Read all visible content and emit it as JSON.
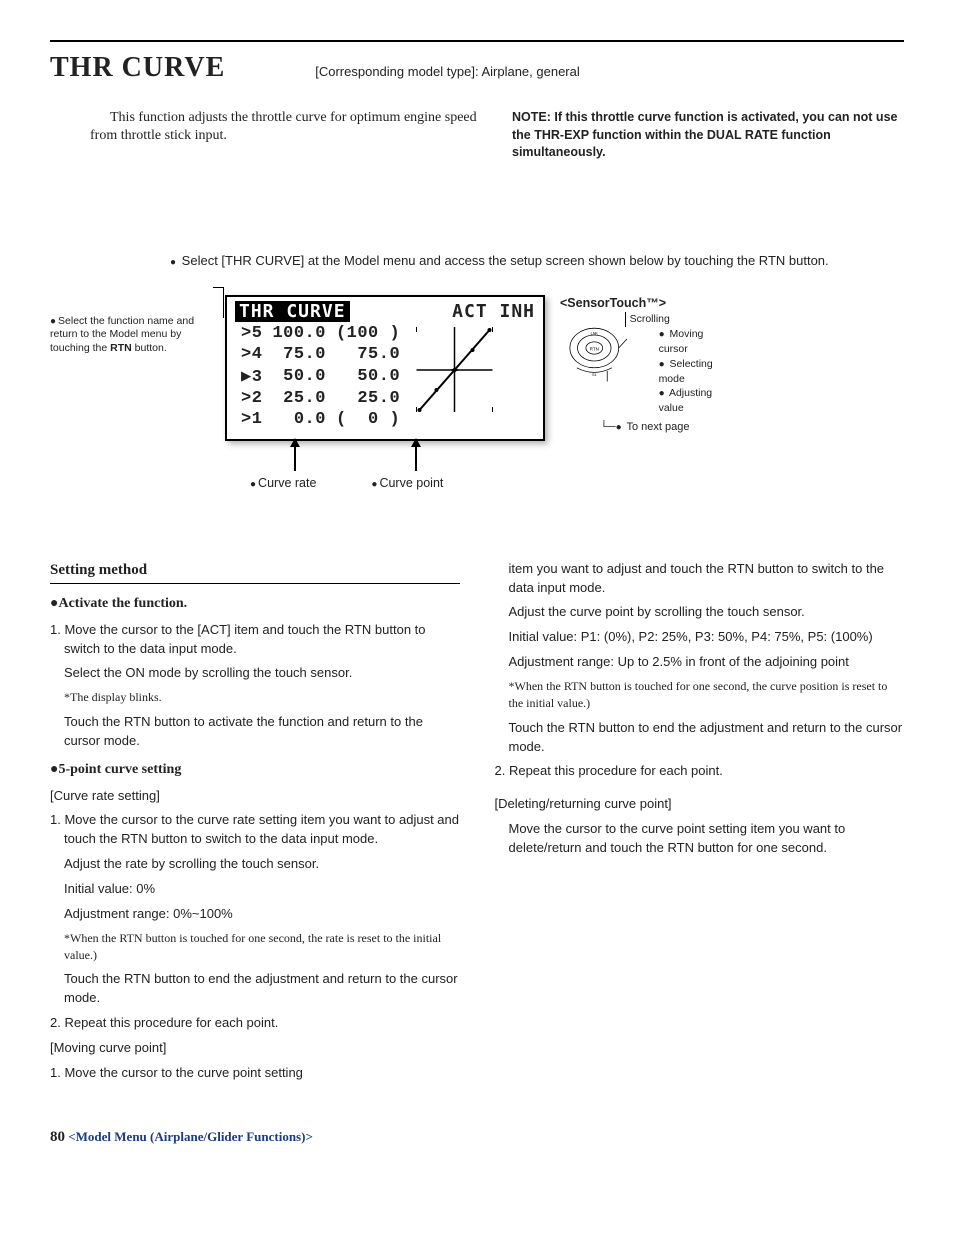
{
  "page_title": "THR CURVE",
  "corresponding": "[Corresponding model type]: Airplane, general",
  "intro_left": "This function adjusts the throttle curve for optimum engine speed from throttle stick input.",
  "intro_right": "NOTE: If this throttle curve function is activated, you can not use the THR-EXP function within the DUAL RATE function simultaneously.",
  "select_instr": "Select [THR CURVE] at the Model menu and access the setup screen shown below by touching the RTN button.",
  "left_note_a": "Select the function name and return to the Model menu by touching the ",
  "left_note_b": "RTN",
  "left_note_c": " button.",
  "lcd": {
    "title": "THR CURVE",
    "act": "ACT INH",
    "rows": [
      {
        "idx": ">5",
        "rate": "100.0",
        "point": "(100 )"
      },
      {
        "idx": ">4",
        "rate": " 75.0",
        "point": " 75.0"
      },
      {
        "idx": "▶3",
        "rate": " 50.0",
        "point": " 50.0"
      },
      {
        "idx": ">2",
        "rate": " 25.0",
        "point": " 25.0"
      },
      {
        "idx": ">1",
        "rate": "  0.0",
        "point": "(  0 )"
      }
    ]
  },
  "curve_rate_label": "Curve rate",
  "curve_point_label": "Curve point",
  "sensor": {
    "title": "<SensorTouch™>",
    "scrolling": "Scrolling",
    "items": [
      "Moving cursor",
      "Selecting mode",
      "Adjusting value"
    ],
    "next": "To next page"
  },
  "setting_method": "Setting method",
  "activate_hdr": "●Activate the function.",
  "act_1": "1. Move the cursor to the [ACT] item and touch the RTN button to switch to the data input mode.",
  "act_2": "Select the ON mode by scrolling the touch sensor.",
  "act_3": "*The display blinks.",
  "act_4": "Touch the RTN button to activate the function and return to the cursor mode.",
  "five_hdr": "●5-point curve setting",
  "cr_label": "[Curve rate setting]",
  "cr_1": "1. Move the cursor to the curve rate setting item you want to adjust and touch the RTN button to switch to the data input mode.",
  "cr_2": "Adjust the rate by scrolling the touch sensor.",
  "cr_3": "Initial value: 0%",
  "cr_4": "Adjustment range: 0%~100%",
  "cr_5": "*When the RTN button is touched for one second, the rate is reset to the initial value.)",
  "cr_6": "Touch the RTN button to end the adjustment and return to the cursor mode.",
  "cr_7": "2. Repeat this procedure for each point.",
  "mv_label": "[Moving curve point]",
  "mv_1": "1. Move the cursor to the curve point setting",
  "mv_2": "item you want to adjust and touch the RTN button to switch to the data input mode.",
  "mv_3": "Adjust the curve point by scrolling the touch sensor.",
  "mv_4": "Initial value: P1: (0%), P2: 25%, P3: 50%, P4: 75%, P5: (100%)",
  "mv_5": "Adjustment range: Up to 2.5% in front of the adjoining point",
  "mv_6": "*When the RTN button is touched for one second, the curve position is reset to the initial value.)",
  "mv_7": "Touch the RTN button to end the adjustment and return to the cursor mode.",
  "mv_8": "2. Repeat this procedure for each point.",
  "del_label": "[Deleting/returning curve point]",
  "del_1": "Move the cursor to the curve point setting item you want to delete/return and touch the RTN button for one second.",
  "footer_pg": "80",
  "footer_sect": "<Model Menu (Airplane/Glider Functions)>"
}
